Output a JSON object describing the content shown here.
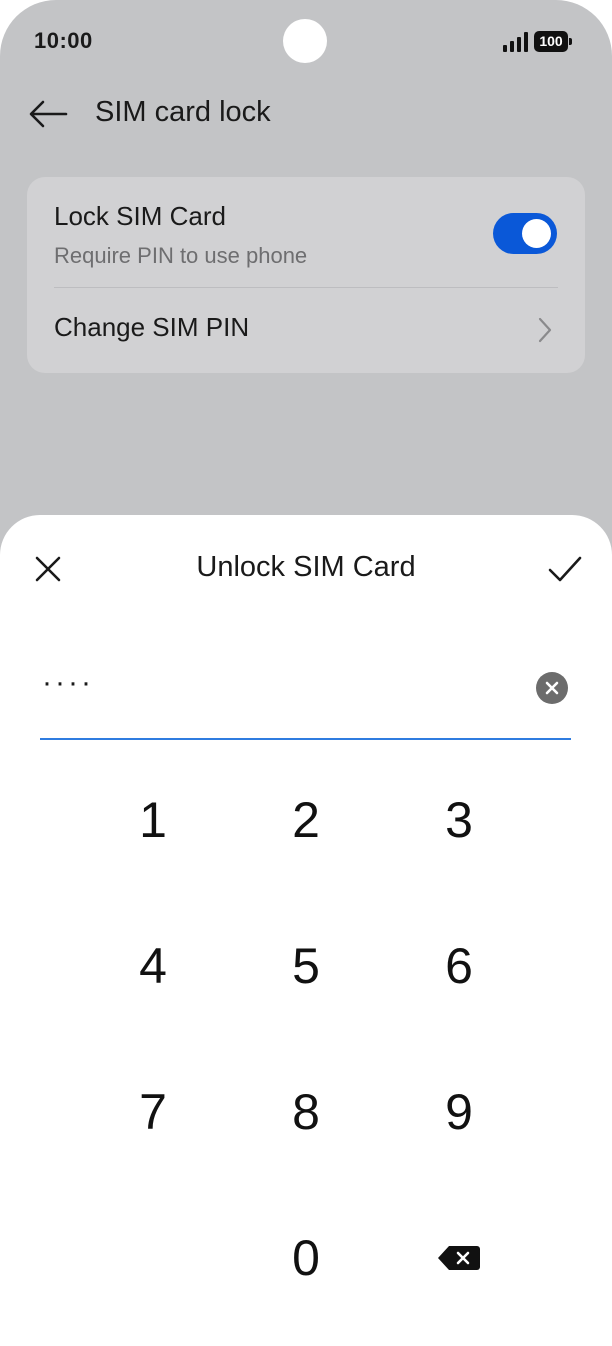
{
  "status_bar": {
    "time": "10:00",
    "battery": "100",
    "icons": [
      "signal-icon",
      "battery-icon"
    ]
  },
  "app_bar": {
    "title": "SIM card lock",
    "back_icon": "arrow-left-icon"
  },
  "settings": {
    "lock_sim": {
      "title": "Lock SIM Card",
      "subtitle": "Require PIN to use phone",
      "enabled": true
    },
    "change_pin": {
      "title": "Change SIM PIN",
      "icon": "chevron-right-icon"
    }
  },
  "dialog": {
    "title": "Unlock SIM Card",
    "close_icon": "close-icon",
    "confirm_icon": "check-icon",
    "pin_masked": "····",
    "clear_icon": "clear-circle-icon"
  },
  "keypad": {
    "keys": [
      "1",
      "2",
      "3",
      "4",
      "5",
      "6",
      "7",
      "8",
      "9",
      "0"
    ],
    "backspace_icon": "backspace-icon"
  },
  "colors": {
    "accent": "#0a58d8",
    "underline": "#2f7ce0",
    "dim_background": "#c3c4c6",
    "card": "#d1d1d3"
  }
}
